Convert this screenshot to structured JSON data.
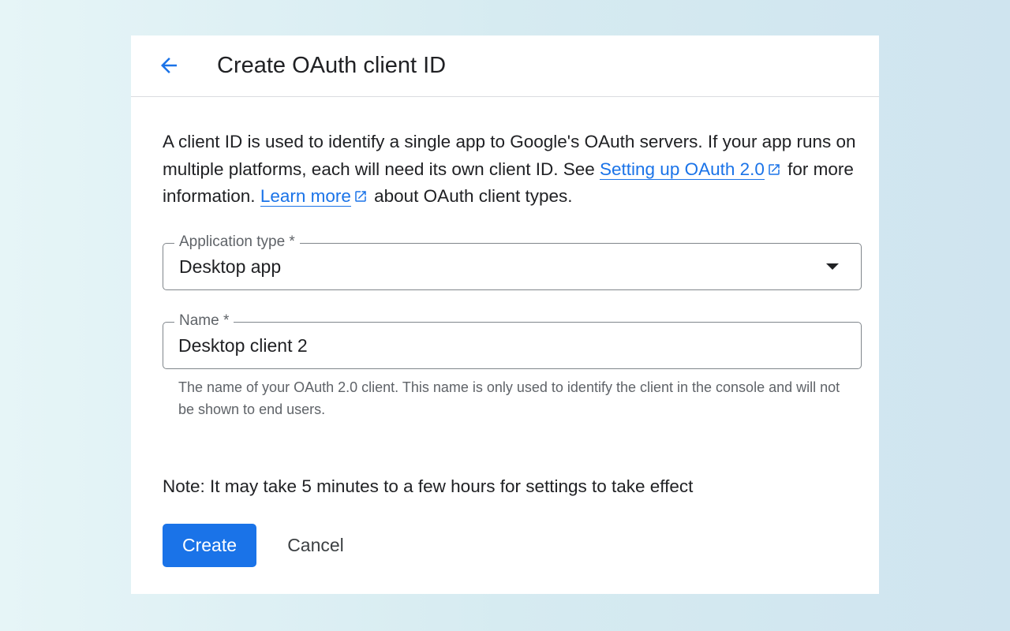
{
  "header": {
    "back_icon": "arrow-back-icon",
    "title": "Create OAuth client ID"
  },
  "description": {
    "text_1": "A client ID is used to identify a single app to Google's OAuth servers. If your app runs on multiple platforms, each will need its own client ID. See ",
    "link_setup": "Setting up OAuth 2.0",
    "text_2": " for more information. ",
    "link_learn": "Learn more",
    "text_3": " about OAuth client types.",
    "external_icon": "open-in-new-icon"
  },
  "application_type": {
    "label": "Application type *",
    "value": "Desktop app",
    "dropdown_icon": "dropdown-arrow-icon"
  },
  "name_field": {
    "label": "Name *",
    "value": "Desktop client 2",
    "hint": "The name of your OAuth 2.0 client. This name is only used to identify the client in the console and will not be shown to end users."
  },
  "note": "Note: It may take 5 minutes to a few hours for settings to take effect",
  "actions": {
    "create_label": "Create",
    "cancel_label": "Cancel"
  },
  "colors": {
    "accent": "#1a73e8",
    "text": "#202124",
    "secondary_text": "#5f6368",
    "border": "#80868b"
  }
}
